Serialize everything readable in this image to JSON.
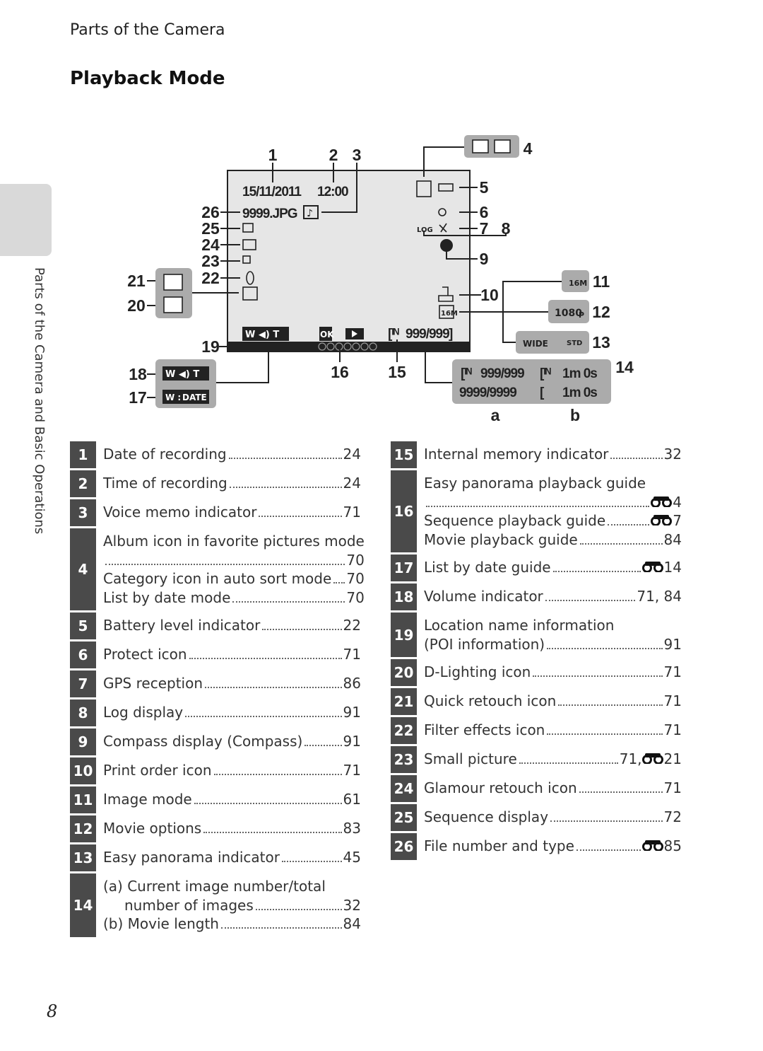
{
  "header": {
    "section": "Parts of the Camera",
    "title": "Playback Mode"
  },
  "side_tab": {
    "label": "Parts of the Camera and Basic Operations"
  },
  "page_number": "8",
  "diagram": {
    "callouts": {
      "c1": "1",
      "c2": "2",
      "c3": "3",
      "c4": "4",
      "c5": "5",
      "c6": "6",
      "c7": "7",
      "c8": "8",
      "c9": "9",
      "c10": "10",
      "c11": "11",
      "c12": "12",
      "c13": "13",
      "c14": "14",
      "c15": "15",
      "c16": "16",
      "c17": "17",
      "c18": "18",
      "c19": "19",
      "c20": "20",
      "c21": "21",
      "c22": "22",
      "c23": "23",
      "c24": "24",
      "c25": "25",
      "c26": "26",
      "a": "a",
      "b": "b"
    },
    "screen": {
      "date": "15/11/2011",
      "time": "12:00",
      "file": "9999.JPG",
      "counter": "999/999",
      "ok": "OK",
      "loc": "LOG",
      "size": "16M"
    },
    "panels": {
      "size": "16M",
      "movie": "1080",
      "movie_suffix": "P",
      "wide": "WIDE",
      "std": "STD",
      "date": "DATE",
      "a1": "999/999",
      "b1": "1m 0s",
      "a2": "9999/9999",
      "b2": "1m 0s"
    }
  },
  "left_table": [
    {
      "num": "1",
      "lines": [
        {
          "text": "Date of recording",
          "page": "24"
        }
      ]
    },
    {
      "num": "2",
      "lines": [
        {
          "text": "Time of recording",
          "page": "24"
        }
      ]
    },
    {
      "num": "3",
      "lines": [
        {
          "text": "Voice memo indicator",
          "page": "71"
        }
      ]
    },
    {
      "num": "4",
      "lines": [
        {
          "text": "Album icon in favorite pictures mode"
        },
        {
          "text": "",
          "page": "70"
        },
        {
          "text": "Category icon in auto sort mode",
          "page": "70"
        },
        {
          "text": "List by date mode",
          "page": "70"
        }
      ]
    },
    {
      "num": "5",
      "lines": [
        {
          "text": "Battery level indicator",
          "page": "22"
        }
      ]
    },
    {
      "num": "6",
      "lines": [
        {
          "text": "Protect icon",
          "page": "71"
        }
      ]
    },
    {
      "num": "7",
      "lines": [
        {
          "text": "GPS reception",
          "page": "86"
        }
      ]
    },
    {
      "num": "8",
      "lines": [
        {
          "text": "Log display",
          "page": "91"
        }
      ]
    },
    {
      "num": "9",
      "lines": [
        {
          "text": "Compass display (Compass)",
          "page": "91"
        }
      ]
    },
    {
      "num": "10",
      "lines": [
        {
          "text": "Print order icon",
          "page": "71"
        }
      ]
    },
    {
      "num": "11",
      "lines": [
        {
          "text": "Image mode",
          "page": "61"
        }
      ]
    },
    {
      "num": "12",
      "lines": [
        {
          "text": "Movie options",
          "page": "83"
        }
      ]
    },
    {
      "num": "13",
      "lines": [
        {
          "text": "Easy panorama indicator",
          "page": "45"
        }
      ]
    },
    {
      "num": "14",
      "lines": [
        {
          "text": "(a) Current image number/total"
        },
        {
          "text": "number of images",
          "page": "32",
          "indent": true
        },
        {
          "text": "(b) Movie length",
          "page": "84"
        }
      ]
    }
  ],
  "right_table": [
    {
      "num": "15",
      "lines": [
        {
          "text": "Internal memory indicator",
          "page": "32"
        }
      ]
    },
    {
      "num": "16",
      "lines": [
        {
          "text": "Easy panorama playback guide"
        },
        {
          "text": "",
          "page": "4",
          "ref": true
        },
        {
          "text": "Sequence playback guide",
          "page": "7",
          "ref": true
        },
        {
          "text": "Movie playback guide",
          "page": "84"
        }
      ]
    },
    {
      "num": "17",
      "lines": [
        {
          "text": "List by date guide",
          "page": "14",
          "ref": true
        }
      ]
    },
    {
      "num": "18",
      "lines": [
        {
          "text": "Volume indicator",
          "page": "71, 84"
        }
      ]
    },
    {
      "num": "19",
      "lines": [
        {
          "text": "Location name information"
        },
        {
          "text": "(POI information)",
          "page": "91"
        }
      ]
    },
    {
      "num": "20",
      "lines": [
        {
          "text": "D-Lighting icon",
          "page": "71"
        }
      ]
    },
    {
      "num": "21",
      "lines": [
        {
          "text": "Quick retouch icon",
          "page": "71"
        }
      ]
    },
    {
      "num": "22",
      "lines": [
        {
          "text": "Filter effects icon",
          "page": "71"
        }
      ]
    },
    {
      "num": "23",
      "lines": [
        {
          "text": "Small picture",
          "page_prefix": "71, ",
          "page": "21",
          "ref": true
        }
      ]
    },
    {
      "num": "24",
      "lines": [
        {
          "text": "Glamour retouch icon",
          "page": "71"
        }
      ]
    },
    {
      "num": "25",
      "lines": [
        {
          "text": "Sequence display",
          "page": "72"
        }
      ]
    },
    {
      "num": "26",
      "lines": [
        {
          "text": "File number and type",
          "page": "85",
          "ref": true
        }
      ]
    }
  ],
  "colors": {
    "number_box": "#4a4a4a",
    "panel": "#ababab",
    "screen": "#e6e6e6"
  }
}
